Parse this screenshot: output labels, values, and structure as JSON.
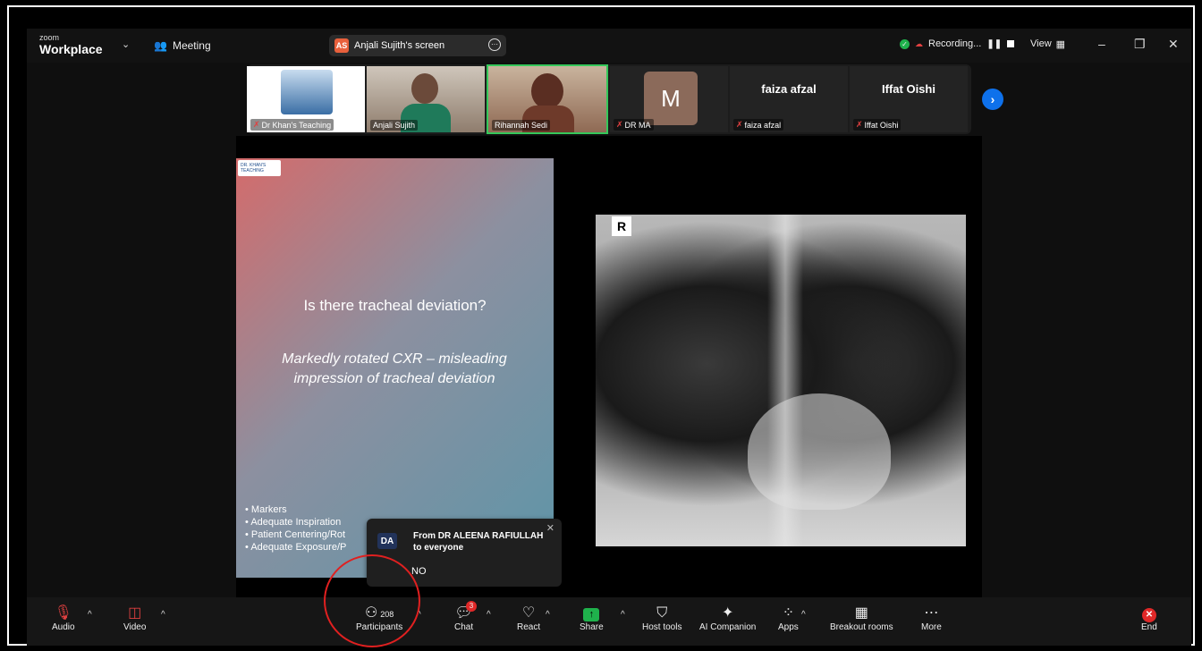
{
  "titlebar": {
    "brand_small": "zoom",
    "brand_big": "Workplace",
    "meeting_label": "Meeting",
    "screen_badge": "AS",
    "screen_label": "Anjali Sujith's screen",
    "recording_label": "Recording...",
    "view_label": "View"
  },
  "gallery": {
    "tiles": [
      {
        "name": "Dr Khan's Teaching",
        "big": ""
      },
      {
        "name": "Anjali Sujith",
        "big": ""
      },
      {
        "name": "Rihannah Sedi",
        "big": ""
      },
      {
        "name": "DR MA",
        "big": "M"
      },
      {
        "name": "faiza afzal",
        "big": "faiza afzal"
      },
      {
        "name": "Iffat Oishi",
        "big": "Iffat Oishi"
      }
    ]
  },
  "slide": {
    "logo_text": "DR. KHAN'S TEACHING",
    "title": "Is there tracheal deviation?",
    "subtitle": "Markedly rotated CXR – misleading impression of tracheal deviation",
    "bullets": [
      "Markers",
      "Adequate Inspiration",
      "Patient Centering/Rot",
      "Adequate Exposure/P"
    ]
  },
  "xray": {
    "marker": "R"
  },
  "toast": {
    "avatar": "DA",
    "from": "From DR ALEENA RAFIULLAH",
    "to": "to everyone",
    "message": "NO"
  },
  "toolbar": {
    "audio": "Audio",
    "video": "Video",
    "participants": "Participants",
    "participants_count": "208",
    "chat": "Chat",
    "chat_badge": "3",
    "react": "React",
    "share": "Share",
    "host_tools": "Host tools",
    "ai_companion": "AI Companion",
    "apps": "Apps",
    "breakout": "Breakout rooms",
    "more": "More",
    "end": "End"
  }
}
